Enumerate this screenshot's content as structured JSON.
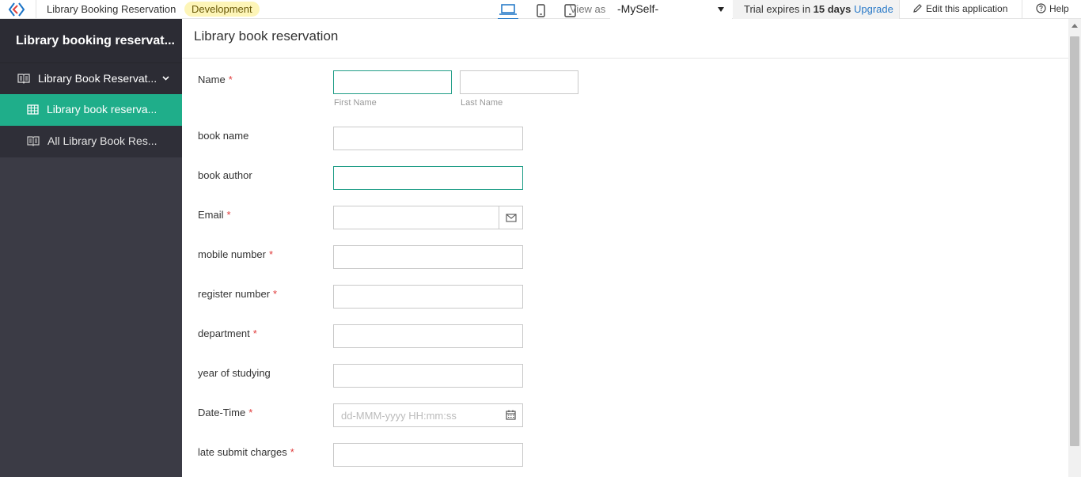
{
  "topbar": {
    "app_name": "Library Booking Reservation",
    "env_badge": "Development",
    "view_as_label": "View as",
    "view_as_value": "-MySelf-",
    "trial_prefix": "Trial expires in",
    "trial_days": "15 days",
    "upgrade_label": "Upgrade",
    "edit_label": "Edit this application",
    "help_label": "Help"
  },
  "sidebar": {
    "app_title": "Library booking reservat...",
    "section_label": "Library Book Reservat...",
    "items": [
      {
        "label": "Library book reserva...",
        "active": true
      },
      {
        "label": "All Library Book Res...",
        "active": false
      }
    ]
  },
  "form": {
    "title": "Library book reservation",
    "name_label": "Name",
    "first_name_label": "First Name",
    "last_name_label": "Last Name",
    "book_name_label": "book name",
    "book_author_label": "book author",
    "email_label": "Email",
    "mobile_label": "mobile number",
    "register_label": "register number",
    "department_label": "department",
    "year_label": "year of studying",
    "datetime_label": "Date-Time",
    "datetime_placeholder": "dd-MMM-yyyy HH:mm:ss",
    "late_label": "late submit charges",
    "required_mark": "*"
  },
  "colors": {
    "accent": "#1fae8a",
    "sidebar_bg": "#3b3b45",
    "link": "#2a7ac8",
    "required": "#e03b3b",
    "badge_bg": "#fdf5b8"
  },
  "icons": [
    "app-logo-icon",
    "laptop-icon",
    "mobile-icon",
    "tablet-icon",
    "caret-down-icon",
    "pencil-icon",
    "help-circle-icon",
    "book-icon",
    "table-icon",
    "envelope-icon",
    "calendar-icon"
  ]
}
